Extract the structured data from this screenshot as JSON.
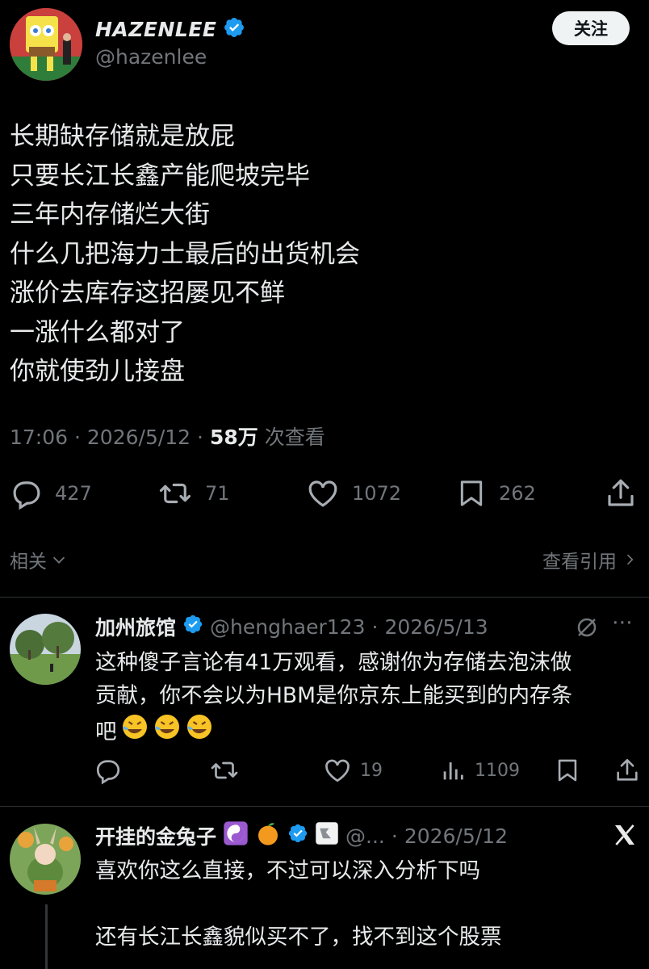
{
  "author": {
    "name": "HAZENLEE",
    "handle": "@hazenlee",
    "follow_label": "关注"
  },
  "tweet": {
    "lines": [
      "长期缺存储就是放屁",
      "只要长江长鑫产能爬坡完毕",
      "三年内存储烂大街",
      "什么几把海力士最后的出货机会",
      "涨价去库存这招屡见不鲜",
      "一涨什么都对了",
      "你就使劲儿接盘"
    ],
    "time": "17:06",
    "date": "2026/5/12",
    "views": "58万",
    "views_label": "次查看",
    "sep": "·"
  },
  "actions": {
    "replies": "427",
    "retweets": "71",
    "likes": "1072",
    "bookmarks": "262"
  },
  "related": {
    "label": "相关",
    "quotes_label": "查看引用"
  },
  "replies": [
    {
      "name": "加州旅馆",
      "handle": "@henghaer123",
      "date": "2026/5/13",
      "sep": "·",
      "text_lines": [
        "这种傻子言论有41万观看，感谢你为存储去泡沫做",
        "贡献，你不会以为HBM是你京东上能买到的内存条",
        "吧"
      ],
      "reply_count": "",
      "retweet_count": "",
      "like_count": "19",
      "view_count": "1109"
    },
    {
      "name": "开挂的金兔子",
      "handle": "@...",
      "date": "2026/5/12",
      "sep": "·",
      "text_lines": [
        "喜欢你这么直接，不过可以深入分析下吗",
        "",
        "还有长江长鑫貌似买不了，找不到这个股票"
      ]
    }
  ],
  "colors": {
    "background": "#000000",
    "text": "#e7e9ea",
    "secondary": "#71767b",
    "verified": "#1d9bf0",
    "divider": "#2f3336"
  }
}
